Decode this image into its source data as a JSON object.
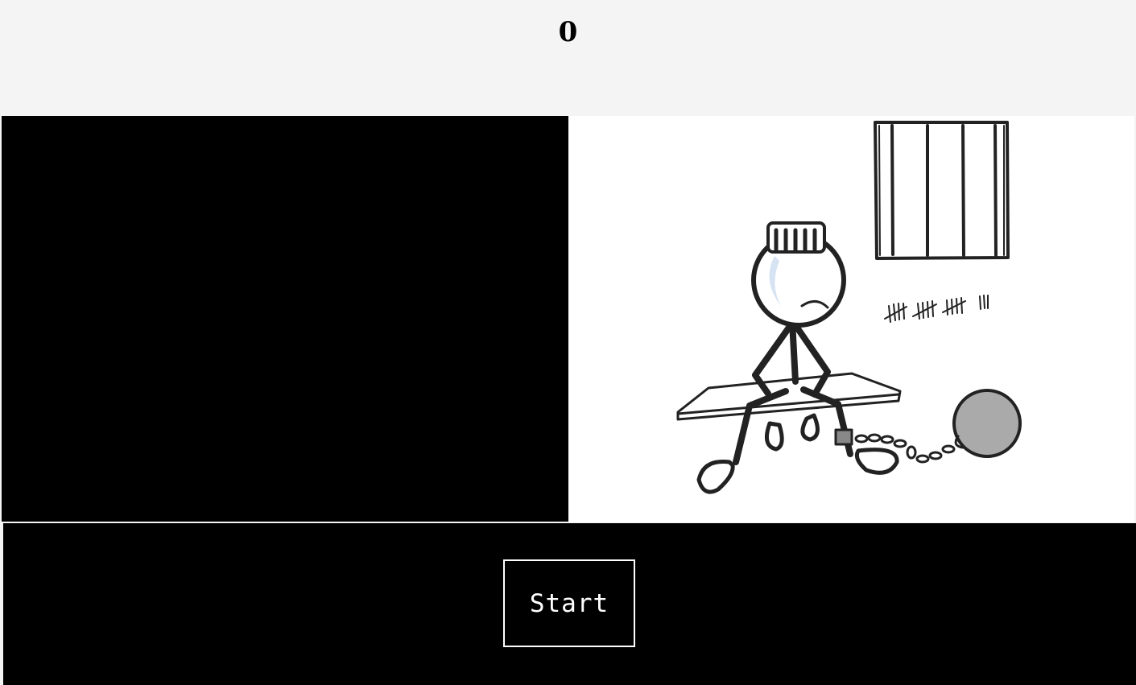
{
  "game": {
    "score": "0",
    "start_label": "Start",
    "scene_image": "prisoner-in-cell-illustration"
  },
  "colors": {
    "header_bg": "#f4f4f4",
    "panel_bg": "#000000",
    "button_border": "#ffffff",
    "button_text": "#ffffff"
  }
}
